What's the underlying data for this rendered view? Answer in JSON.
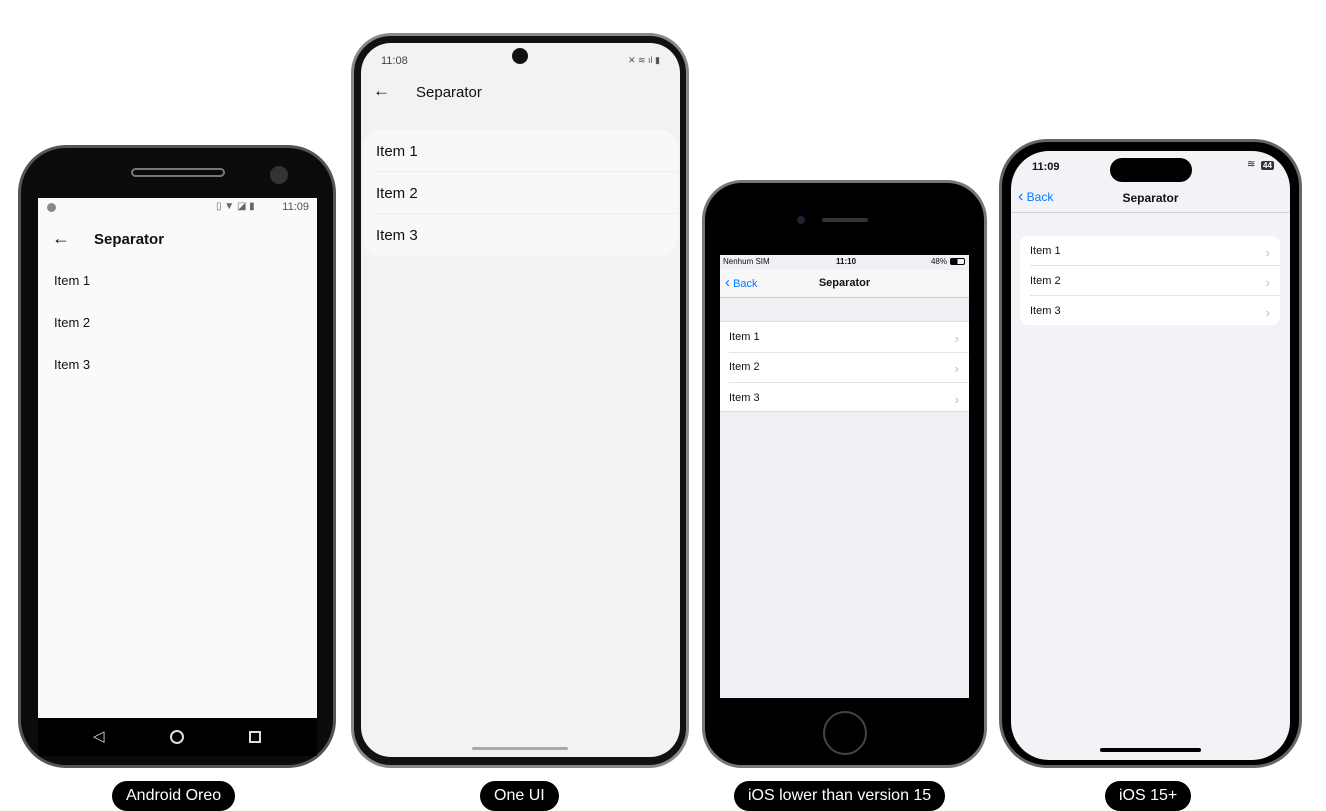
{
  "devices": [
    {
      "label": "Android Oreo",
      "status_time": "11:09",
      "title": "Separator",
      "items": [
        "Item 1",
        "Item 2",
        "Item 3"
      ]
    },
    {
      "label": "One UI",
      "status_time": "11:08",
      "title": "Separator",
      "items": [
        "Item 1",
        "Item 2",
        "Item 3"
      ]
    },
    {
      "label": "iOS lower than version 15",
      "carrier": "Nenhum SIM",
      "status_time": "11:10",
      "battery": "48%",
      "back": "Back",
      "title": "Separator",
      "items": [
        "Item 1",
        "Item 2",
        "Item 3"
      ]
    },
    {
      "label": "iOS 15+",
      "status_time": "11:09",
      "battery": "44",
      "back": "Back",
      "title": "Separator",
      "items": [
        "Item 1",
        "Item 2",
        "Item 3"
      ]
    }
  ],
  "colors": {
    "ios_blue": "#007aff",
    "ios_bg": "#f2f2f7"
  }
}
